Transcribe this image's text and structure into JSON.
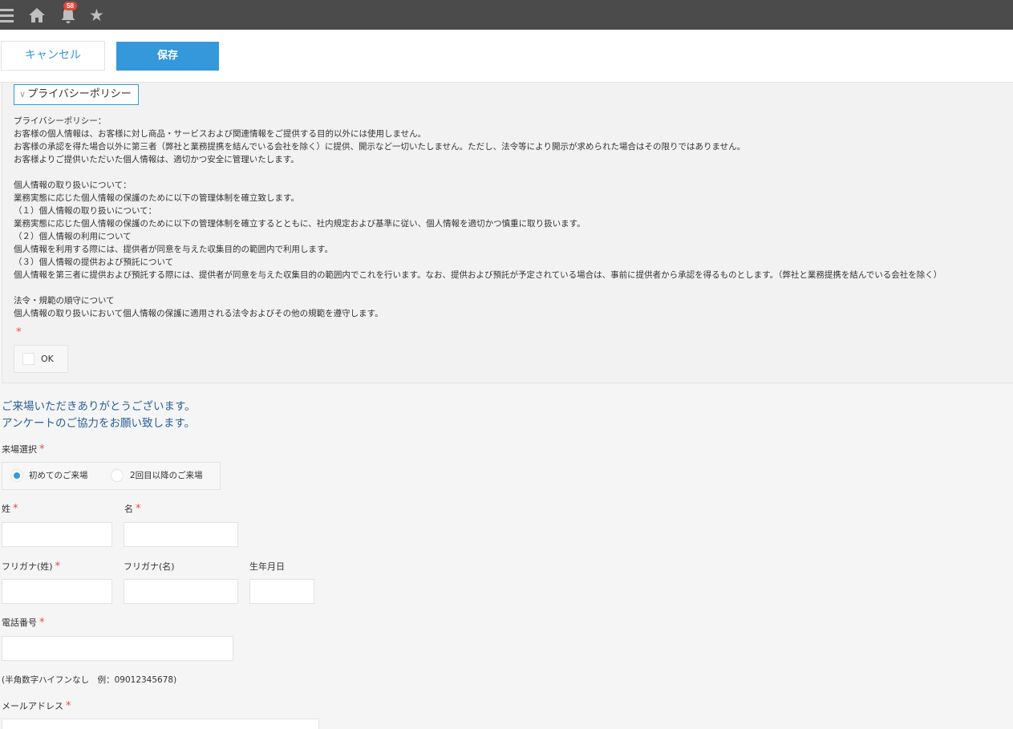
{
  "topbar": {
    "icons": [
      "menu-icon",
      "home-icon",
      "bell-icon",
      "star-icon"
    ],
    "notification_count": "58"
  },
  "actions": {
    "cancel_label": "キャンセル",
    "save_label": "保存"
  },
  "privacy": {
    "toggle_label": "プライバシーポリシー",
    "lines": [
      "プライバシーポリシー：",
      "お客様の個人情報は、お客様に対し商品・サービスおよび関連情報をご提供する目的以外には使用しません。",
      "お客様の承認を得た場合以外に第三者（弊社と業務提携を結んでいる会社を除く）に提供、開示など一切いたしません。ただし、法令等により開示が求められた場合はその限りではありません。",
      "お客様よりご提供いただいた個人情報は、適切かつ安全に管理いたします。",
      "",
      "個人情報の取り扱いについて：",
      "業務実態に応じた個人情報の保護のために以下の管理体制を確立致します。",
      "（１）個人情報の取り扱いについて：",
      "業務実態に応じた個人情報の保護のために以下の管理体制を確立するとともに、社内規定および基準に従い、個人情報を適切かつ慎重に取り扱います。",
      "（２）個人情報の利用について",
      "個人情報を利用する際には、提供者が同意を与えた収集目的の範囲内で利用します。",
      "（３）個人情報の提供および預託について",
      "個人情報を第三者に提供および預託する際には、提供者が同意を与えた収集目的の範囲内でこれを行います。なお、提供および預託が予定されている場合は、事前に提供者から承認を得るものとします。（弊社と業務提携を結んでいる会社を除く）",
      "",
      "法令・規範の順守について",
      "個人情報の取り扱いにおいて個人情報の保護に適用される法令およびその他の規範を遵守します。"
    ],
    "required_mark": "*",
    "agree_label": "OK",
    "agree_checked": false
  },
  "form": {
    "greeting_line1": "ご来場いただきありがとうございます。",
    "greeting_line2": "アンケートのご協力をお願い致します。",
    "required_mark": "*",
    "visit_label": "来場選択",
    "visit_options": [
      "初めてのご来場",
      "2回目以降のご来場"
    ],
    "visit_selected": "初めてのご来場",
    "last_name_label": "姓",
    "first_name_label": "名",
    "last_kana_label": "フリガナ(姓)",
    "first_kana_label": "フリガナ(名)",
    "birthday_label": "生年月日",
    "phone_label": "電話番号",
    "phone_hint": "(半角数字ハイフンなし　例：09012345678)",
    "email_label": "メールアドレス",
    "values": {
      "last_name": "",
      "first_name": "",
      "last_kana": "",
      "first_kana": "",
      "birthday": "",
      "phone": "",
      "email": ""
    }
  }
}
